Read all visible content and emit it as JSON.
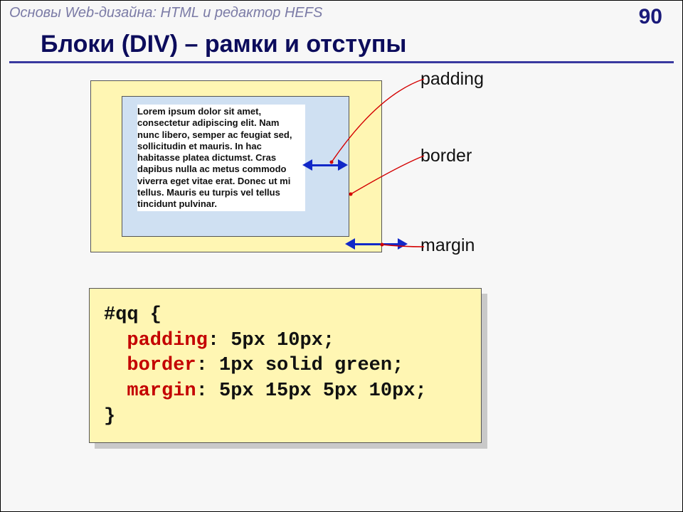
{
  "header": {
    "breadcrumb": "Основы Web-дизайна: HTML и редактор HEFS",
    "page_number": "90"
  },
  "title": "Блоки (DIV) – рамки и отступы",
  "labels": {
    "padding": "padding",
    "border": "border",
    "margin": "margin"
  },
  "lorem": "Lorem ipsum dolor sit amet, consectetur adipiscing elit. Nam nunc libero, semper ac feugiat sed, sollicitudin et mauris. In hac habitasse platea dictumst. Cras dapibus nulla ac metus commodo viverra eget vitae erat. Donec ut mi tellus. Mauris eu turpis vel tellus tincidunt pulvinar.",
  "code": {
    "selector": "#qq {",
    "padding_kw": "padding",
    "padding_val": ": 5px 10px;",
    "border_kw": "border",
    "border_val": ": 1px solid green;",
    "margin_kw": "margin",
    "margin_val": ": 5px 15px 5px 10px;",
    "close": "}"
  }
}
